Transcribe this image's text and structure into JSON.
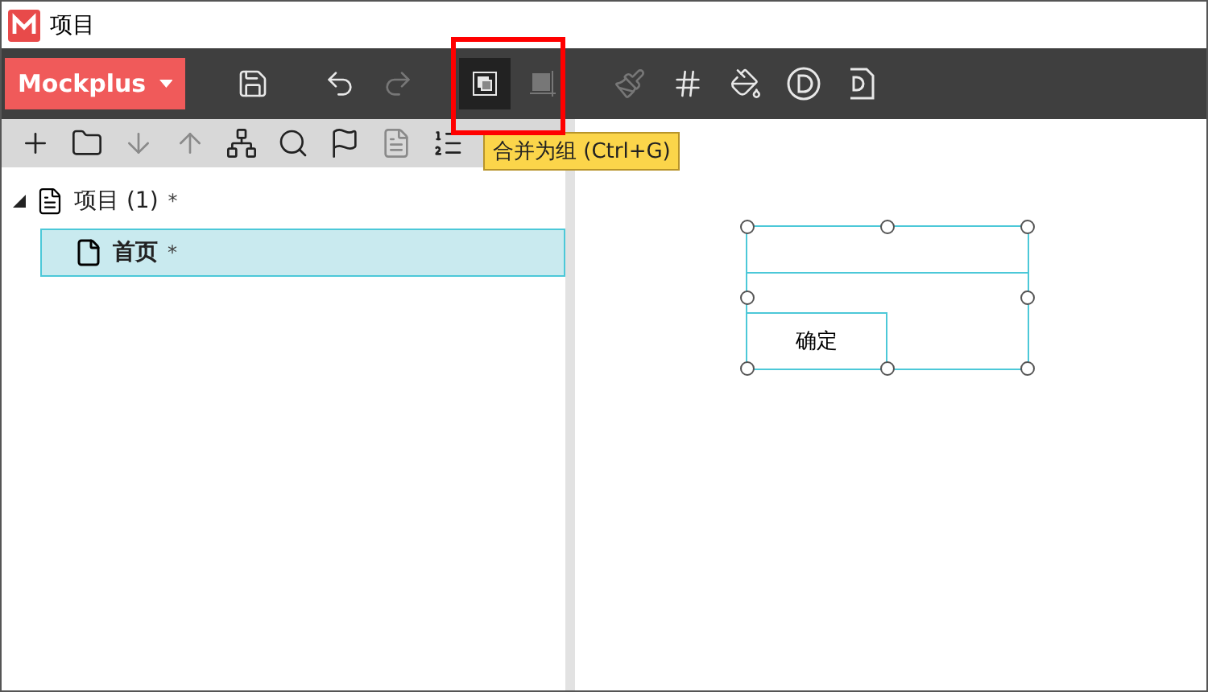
{
  "window": {
    "title": "项目"
  },
  "brand": {
    "label": "Mockplus"
  },
  "toolbar": [
    {
      "kind": "save",
      "disabled": false,
      "selected": false
    },
    {
      "kind": "undo",
      "disabled": false,
      "selected": false
    },
    {
      "kind": "redo",
      "disabled": true,
      "selected": false
    },
    {
      "kind": "group",
      "disabled": false,
      "selected": true
    },
    {
      "kind": "ungroup",
      "disabled": true,
      "selected": false
    },
    {
      "kind": "brush",
      "disabled": true,
      "selected": false
    },
    {
      "kind": "grid",
      "disabled": false,
      "selected": false
    },
    {
      "kind": "bucket",
      "disabled": false,
      "selected": false
    },
    {
      "kind": "d-circle",
      "disabled": false,
      "selected": false
    },
    {
      "kind": "d-file",
      "disabled": false,
      "selected": false
    }
  ],
  "tooltip": {
    "text": "合并为组 (Ctrl+G)"
  },
  "panel_toolbar": [
    {
      "kind": "plus",
      "disabled": false
    },
    {
      "kind": "folder",
      "disabled": false
    },
    {
      "kind": "down",
      "disabled": true
    },
    {
      "kind": "up",
      "disabled": true
    },
    {
      "kind": "tree",
      "disabled": false
    },
    {
      "kind": "search",
      "disabled": false
    },
    {
      "kind": "flag",
      "disabled": false
    },
    {
      "kind": "file",
      "disabled": true
    },
    {
      "kind": "list",
      "disabled": false
    }
  ],
  "tree": [
    {
      "label": "项目 (1)",
      "mark": "*",
      "expanded": true,
      "selected": false,
      "children": [
        {
          "label": "首页",
          "mark": "*",
          "selected": true
        }
      ]
    }
  ],
  "canvas": {
    "button": "确定"
  }
}
